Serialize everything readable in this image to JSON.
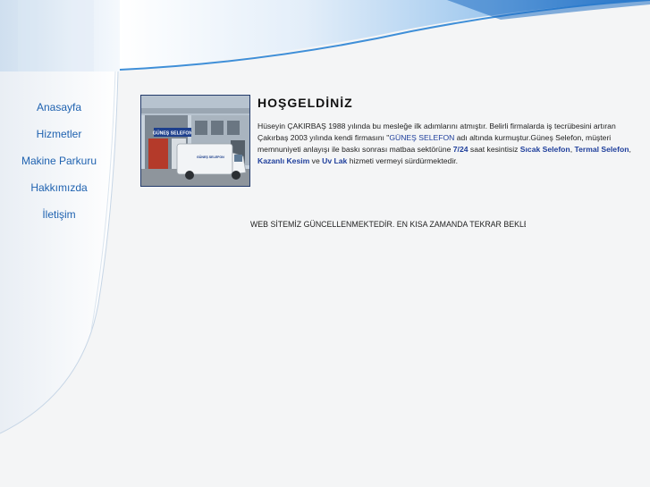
{
  "nav": {
    "items": [
      "Anasayfa",
      "Hizmetler",
      "Makine Parkuru",
      "Hakkımızda",
      "İletişim"
    ]
  },
  "content": {
    "title": "HOŞGELDİNİZ",
    "p_text1": "Hüseyin ÇAKIRBAŞ 1988 yılında bu mesleğe ilk adımlarını atmıştır. Belirli firmalarda iş tecrübesini artıran Çakırbaş 2003 yılında kendi firmasını \"",
    "p_link": "GÜNEŞ SELEFON",
    "p_text2": "  adı altında kurmuştur.Güneş Selefon, müşteri memnuniyeti anlayışı ile baskı sonrası matbaa sektörüne ",
    "p_b1": "7/24",
    "p_text3": " saat kesintisiz ",
    "p_b2": "Sıcak Selefon",
    "p_text4": ", ",
    "p_b3": "Termal Selefon",
    "p_text5": ", ",
    "p_b4": "Kazanlı Kesim",
    "p_text6": " ve ",
    "p_b5": "Uv Lak",
    "p_text7": " hizmeti vermeyi sürdürmektedir.",
    "notice": "WEB SİTEMİZ GÜNCELLENMEKTEDİR. EN KISA ZAMANDA TEKRAR BEKLERİZ"
  },
  "photo": {
    "sign_text": "GÜNEŞ SELEFON",
    "van_text": "GÜNEŞ SELEFON"
  },
  "colors": {
    "nav_link": "#1f62b0",
    "accent_blue": "#1f3f9c",
    "header_blue": "#3f8fd8"
  }
}
